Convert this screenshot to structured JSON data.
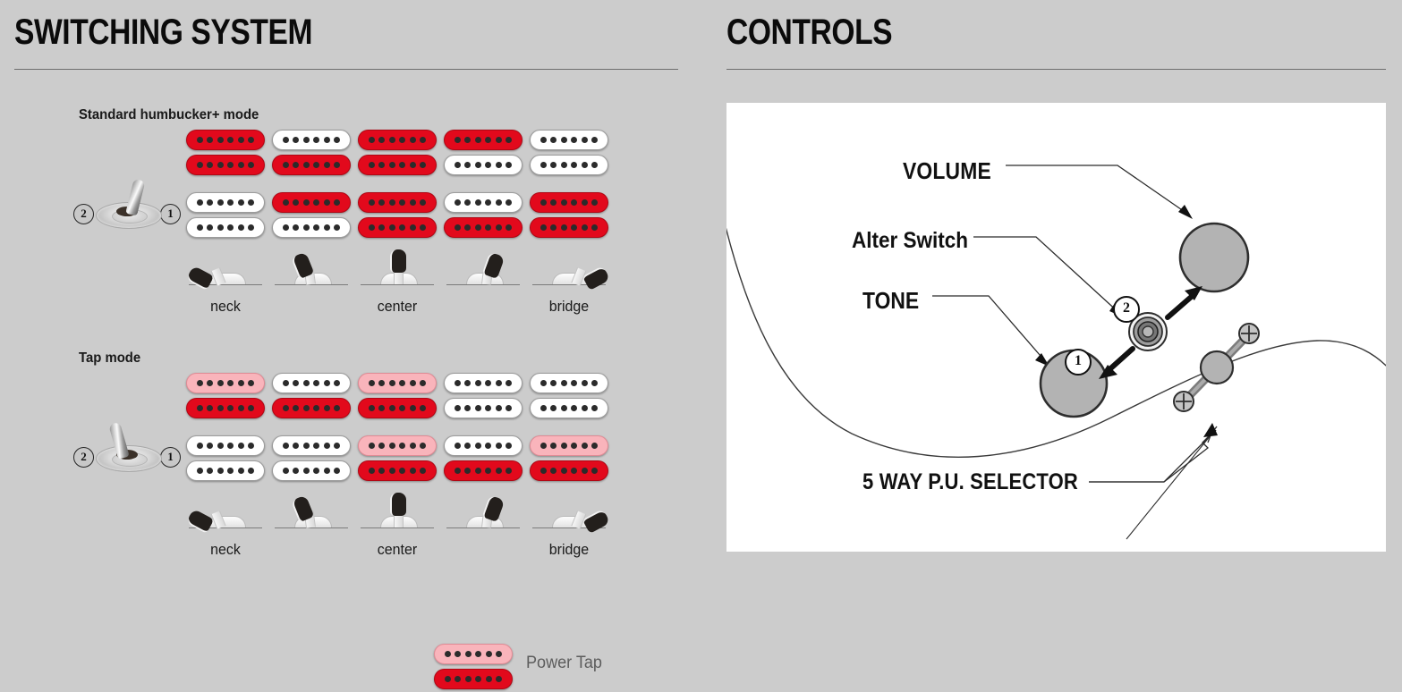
{
  "panels": {
    "left": {
      "title": "SWITCHING SYSTEM"
    },
    "right": {
      "title": "CONTROLS"
    }
  },
  "colors": {
    "background": "#cccccc",
    "panel": "#ffffff",
    "coil_active": "#e2091c",
    "coil_tapped": "#f9b4bb",
    "coil_off": "#ffffff",
    "pole": "#2b2b2b",
    "rule": "#6e6e6e",
    "knob": "#b3b3b3"
  },
  "switching": {
    "modes": [
      {
        "id": "standard",
        "label": "Standard humbucker+ mode",
        "toggle": {
          "position": "1",
          "lean": "right",
          "left_number": "2",
          "right_number": "1"
        },
        "positions": [
          {
            "selector_label": "neck",
            "neck_pickup": {
              "top_coil": "red",
              "bottom_coil": "red"
            },
            "bridge_pickup": {
              "top_coil": "white",
              "bottom_coil": "white"
            }
          },
          {
            "selector_label": "",
            "neck_pickup": {
              "top_coil": "white",
              "bottom_coil": "red"
            },
            "bridge_pickup": {
              "top_coil": "red",
              "bottom_coil": "white"
            }
          },
          {
            "selector_label": "center",
            "neck_pickup": {
              "top_coil": "red",
              "bottom_coil": "red"
            },
            "bridge_pickup": {
              "top_coil": "red",
              "bottom_coil": "red"
            }
          },
          {
            "selector_label": "",
            "neck_pickup": {
              "top_coil": "red",
              "bottom_coil": "white"
            },
            "bridge_pickup": {
              "top_coil": "white",
              "bottom_coil": "red"
            }
          },
          {
            "selector_label": "bridge",
            "neck_pickup": {
              "top_coil": "white",
              "bottom_coil": "white"
            },
            "bridge_pickup": {
              "top_coil": "red",
              "bottom_coil": "red"
            }
          }
        ]
      },
      {
        "id": "tap",
        "label": "Tap mode",
        "toggle": {
          "position": "2",
          "lean": "left",
          "left_number": "2",
          "right_number": "1"
        },
        "positions": [
          {
            "selector_label": "neck",
            "neck_pickup": {
              "top_coil": "pink",
              "bottom_coil": "red"
            },
            "bridge_pickup": {
              "top_coil": "white",
              "bottom_coil": "white"
            }
          },
          {
            "selector_label": "",
            "neck_pickup": {
              "top_coil": "white",
              "bottom_coil": "red"
            },
            "bridge_pickup": {
              "top_coil": "white",
              "bottom_coil": "white"
            }
          },
          {
            "selector_label": "center",
            "neck_pickup": {
              "top_coil": "pink",
              "bottom_coil": "red"
            },
            "bridge_pickup": {
              "top_coil": "pink",
              "bottom_coil": "red"
            }
          },
          {
            "selector_label": "",
            "neck_pickup": {
              "top_coil": "white",
              "bottom_coil": "white"
            },
            "bridge_pickup": {
              "top_coil": "white",
              "bottom_coil": "red"
            }
          },
          {
            "selector_label": "bridge",
            "neck_pickup": {
              "top_coil": "white",
              "bottom_coil": "white"
            },
            "bridge_pickup": {
              "top_coil": "pink",
              "bottom_coil": "red"
            }
          }
        ]
      }
    ],
    "legend": {
      "label": "Power Tap",
      "swatch": {
        "top_coil": "pink",
        "bottom_coil": "red"
      }
    },
    "pole_count": 6
  },
  "controls": {
    "labels": {
      "volume": "VOLUME",
      "alter_switch": "Alter Switch",
      "tone": "TONE",
      "selector": "5 WAY P.U. SELECTOR"
    },
    "alter_switch_positions": {
      "up": "2",
      "down": "1"
    }
  }
}
